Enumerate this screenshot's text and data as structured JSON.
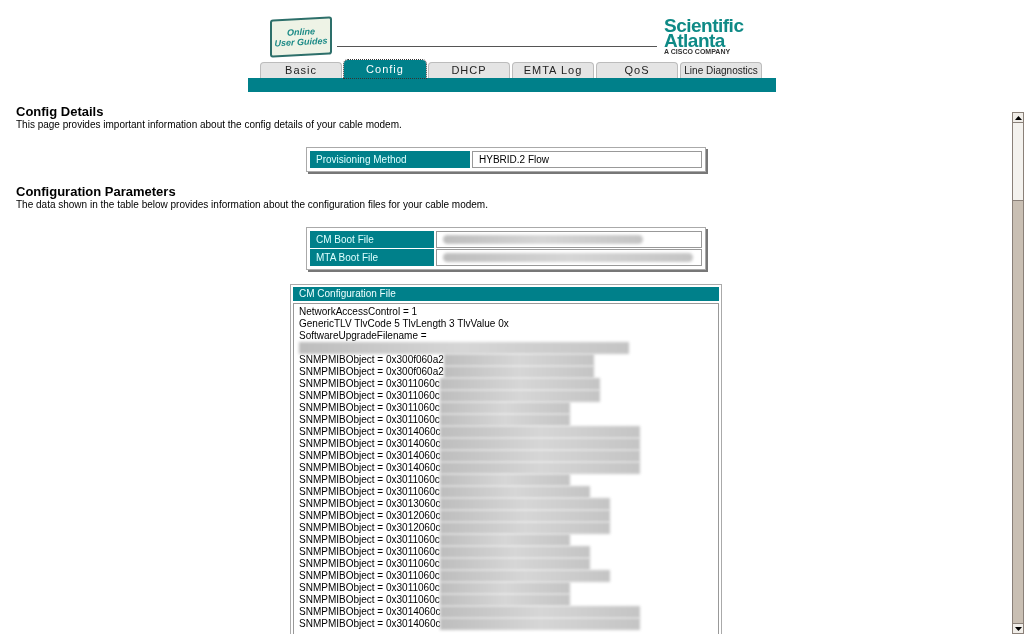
{
  "header": {
    "guide_logo": [
      "Online",
      "User Guides"
    ],
    "brand": [
      "Scientific",
      "Atlanta"
    ],
    "brand_tagline": "A CISCO COMPANY"
  },
  "tabs": [
    {
      "label": "Basic",
      "selected": false
    },
    {
      "label": "Config",
      "selected": true
    },
    {
      "label": "DHCP",
      "selected": false
    },
    {
      "label": "EMTA Log",
      "selected": false
    },
    {
      "label": "QoS",
      "selected": false
    },
    {
      "label": "Line Diagnostics",
      "selected": false
    }
  ],
  "config_details": {
    "title": "Config Details",
    "description": "This page provides important information about the config details of your cable modem.",
    "rows": [
      {
        "label": "Provisioning Method",
        "value": "HYBRID.2 Flow"
      }
    ]
  },
  "configuration_parameters": {
    "title": "Configuration Parameters",
    "description": "The data shown in the table below provides information about the configuration files for your cable modem.",
    "rows": [
      {
        "label": "CM Boot File",
        "redacted": true
      },
      {
        "label": "MTA Boot File",
        "redacted": true
      }
    ]
  },
  "cm_configuration_file": {
    "title": "CM Configuration File",
    "lines": [
      {
        "text": "NetworkAccessControl = 1",
        "redacted": false
      },
      {
        "text": "GenericTLV TlvCode 5 TlvLength 3 TlvValue 0x",
        "redacted": false
      },
      {
        "text": "SoftwareUpgradeFilename =",
        "redacted": false
      },
      {
        "redacted": true
      },
      {
        "text": "SNMPMIBObject = 0x300f060a2",
        "redacted": true
      },
      {
        "text": "SNMPMIBObject = 0x300f060a2",
        "redacted": true
      },
      {
        "text": "SNMPMIBObject = 0x3011060c",
        "redacted": true
      },
      {
        "text": "SNMPMIBObject = 0x3011060c",
        "redacted": true
      },
      {
        "text": "SNMPMIBObject = 0x3011060c",
        "redacted": true
      },
      {
        "text": "SNMPMIBObject = 0x3011060c",
        "redacted": true
      },
      {
        "text": "SNMPMIBObject = 0x3014060c",
        "redacted": true
      },
      {
        "text": "SNMPMIBObject = 0x3014060c",
        "redacted": true
      },
      {
        "text": "SNMPMIBObject = 0x3014060c",
        "redacted": true
      },
      {
        "text": "SNMPMIBObject = 0x3014060c",
        "redacted": true
      },
      {
        "text": "SNMPMIBObject = 0x3011060c",
        "redacted": true
      },
      {
        "text": "SNMPMIBObject = 0x3011060c",
        "redacted": true
      },
      {
        "text": "SNMPMIBObject = 0x3013060c",
        "redacted": true
      },
      {
        "text": "SNMPMIBObject = 0x3012060c",
        "redacted": true
      },
      {
        "text": "SNMPMIBObject = 0x3012060c",
        "redacted": true
      },
      {
        "text": "SNMPMIBObject = 0x3011060c",
        "redacted": true
      },
      {
        "text": "SNMPMIBObject = 0x3011060c",
        "redacted": true
      },
      {
        "text": "SNMPMIBObject = 0x3011060c",
        "redacted": true
      },
      {
        "text": "SNMPMIBObject = 0x3011060c",
        "redacted": true
      },
      {
        "text": "SNMPMIBObject = 0x3011060c",
        "redacted": true
      },
      {
        "text": "SNMPMIBObject = 0x3011060c",
        "redacted": true
      },
      {
        "text": "SNMPMIBObject = 0x3014060c",
        "redacted": true
      },
      {
        "text": "SNMPMIBObject = 0x3014060c",
        "redacted": true
      }
    ]
  }
}
